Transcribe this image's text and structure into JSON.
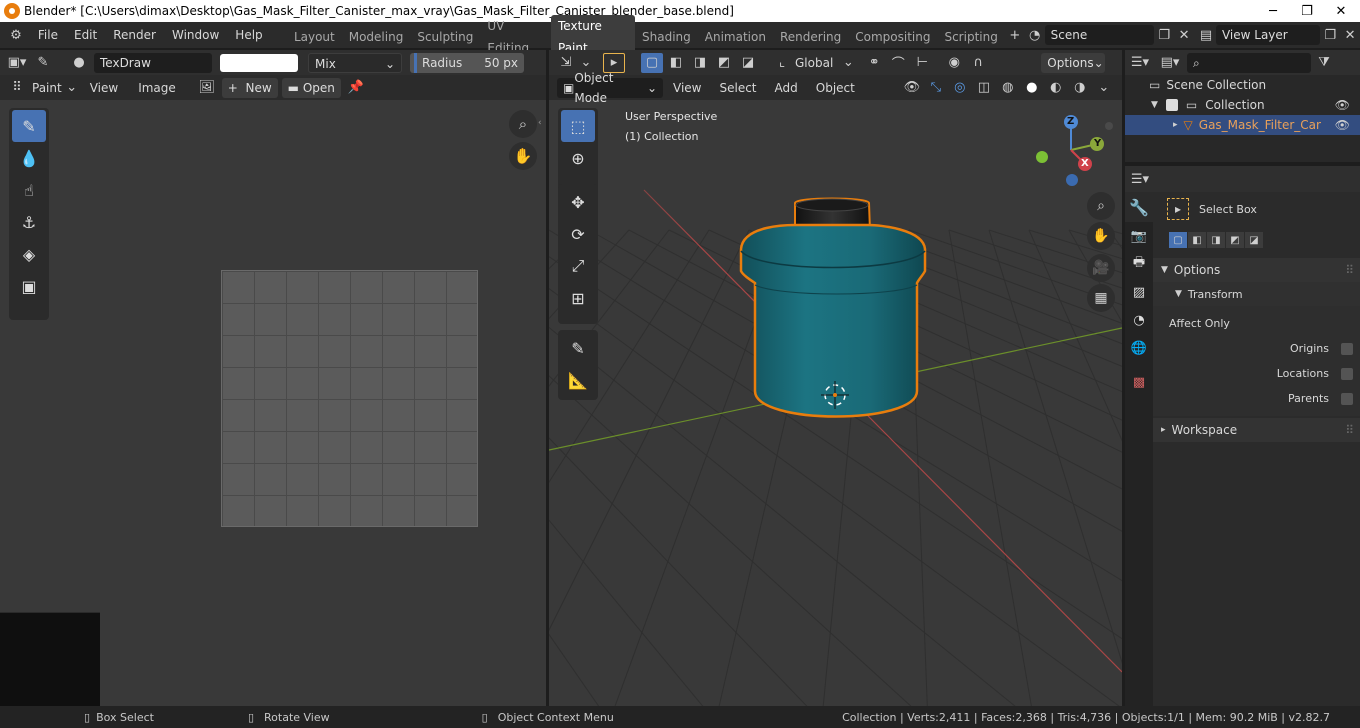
{
  "window": {
    "title": "Blender* [C:\\Users\\dimax\\Desktop\\Gas_Mask_Filter_Canister_max_vray\\Gas_Mask_Filter_Canister_blender_base.blend]",
    "minimize": "─",
    "maximize": "❐",
    "close": "✕"
  },
  "menu": [
    "File",
    "Edit",
    "Render",
    "Window",
    "Help"
  ],
  "workspaces": [
    "Layout",
    "Modeling",
    "Sculpting",
    "UV Editing",
    "Texture Paint",
    "Shading",
    "Animation",
    "Rendering",
    "Compositing",
    "Scripting"
  ],
  "active_workspace": "Texture Paint",
  "scene": {
    "label": "Scene"
  },
  "view_layer": {
    "label": "View Layer"
  },
  "image_editor": {
    "brush_name": "TexDraw",
    "blend_mode": "Mix",
    "radius_label": "Radius",
    "radius_value": "50 px",
    "mode": "Paint",
    "menus": [
      "View",
      "Image"
    ],
    "new_label": "New",
    "open_label": "Open"
  },
  "viewport": {
    "mode": "Object Mode",
    "menus": [
      "View",
      "Select",
      "Add",
      "Object"
    ],
    "orientation": "Global",
    "options_label": "Options",
    "overlay_title": "User Perspective",
    "overlay_collection": "(1) Collection",
    "gizmo": {
      "x": "X",
      "y": "Y",
      "z": "Z"
    }
  },
  "outliner": {
    "scene_collection": "Scene Collection",
    "collection": "Collection",
    "object": "Gas_Mask_Filter_Caniste"
  },
  "properties": {
    "tool_name": "Select Box",
    "options_header": "Options",
    "transform_header": "Transform",
    "affect_only": "Affect Only",
    "origins": "Origins",
    "locations": "Locations",
    "parents": "Parents",
    "workspace_header": "Workspace"
  },
  "statusbar": {
    "box_select": "Box Select",
    "rotate_view": "Rotate View",
    "context_menu": "Object Context Menu",
    "stats": "Collection | Verts:2,411 | Faces:2,368 | Tris:4,736 | Objects:1/1 | Mem: 90.2 MiB | v2.82.7"
  },
  "colors": {
    "accent": "#4772b3",
    "selection_outline": "#e87d0d",
    "canister": "#1b6b78",
    "object_label": "#e8a05a"
  }
}
